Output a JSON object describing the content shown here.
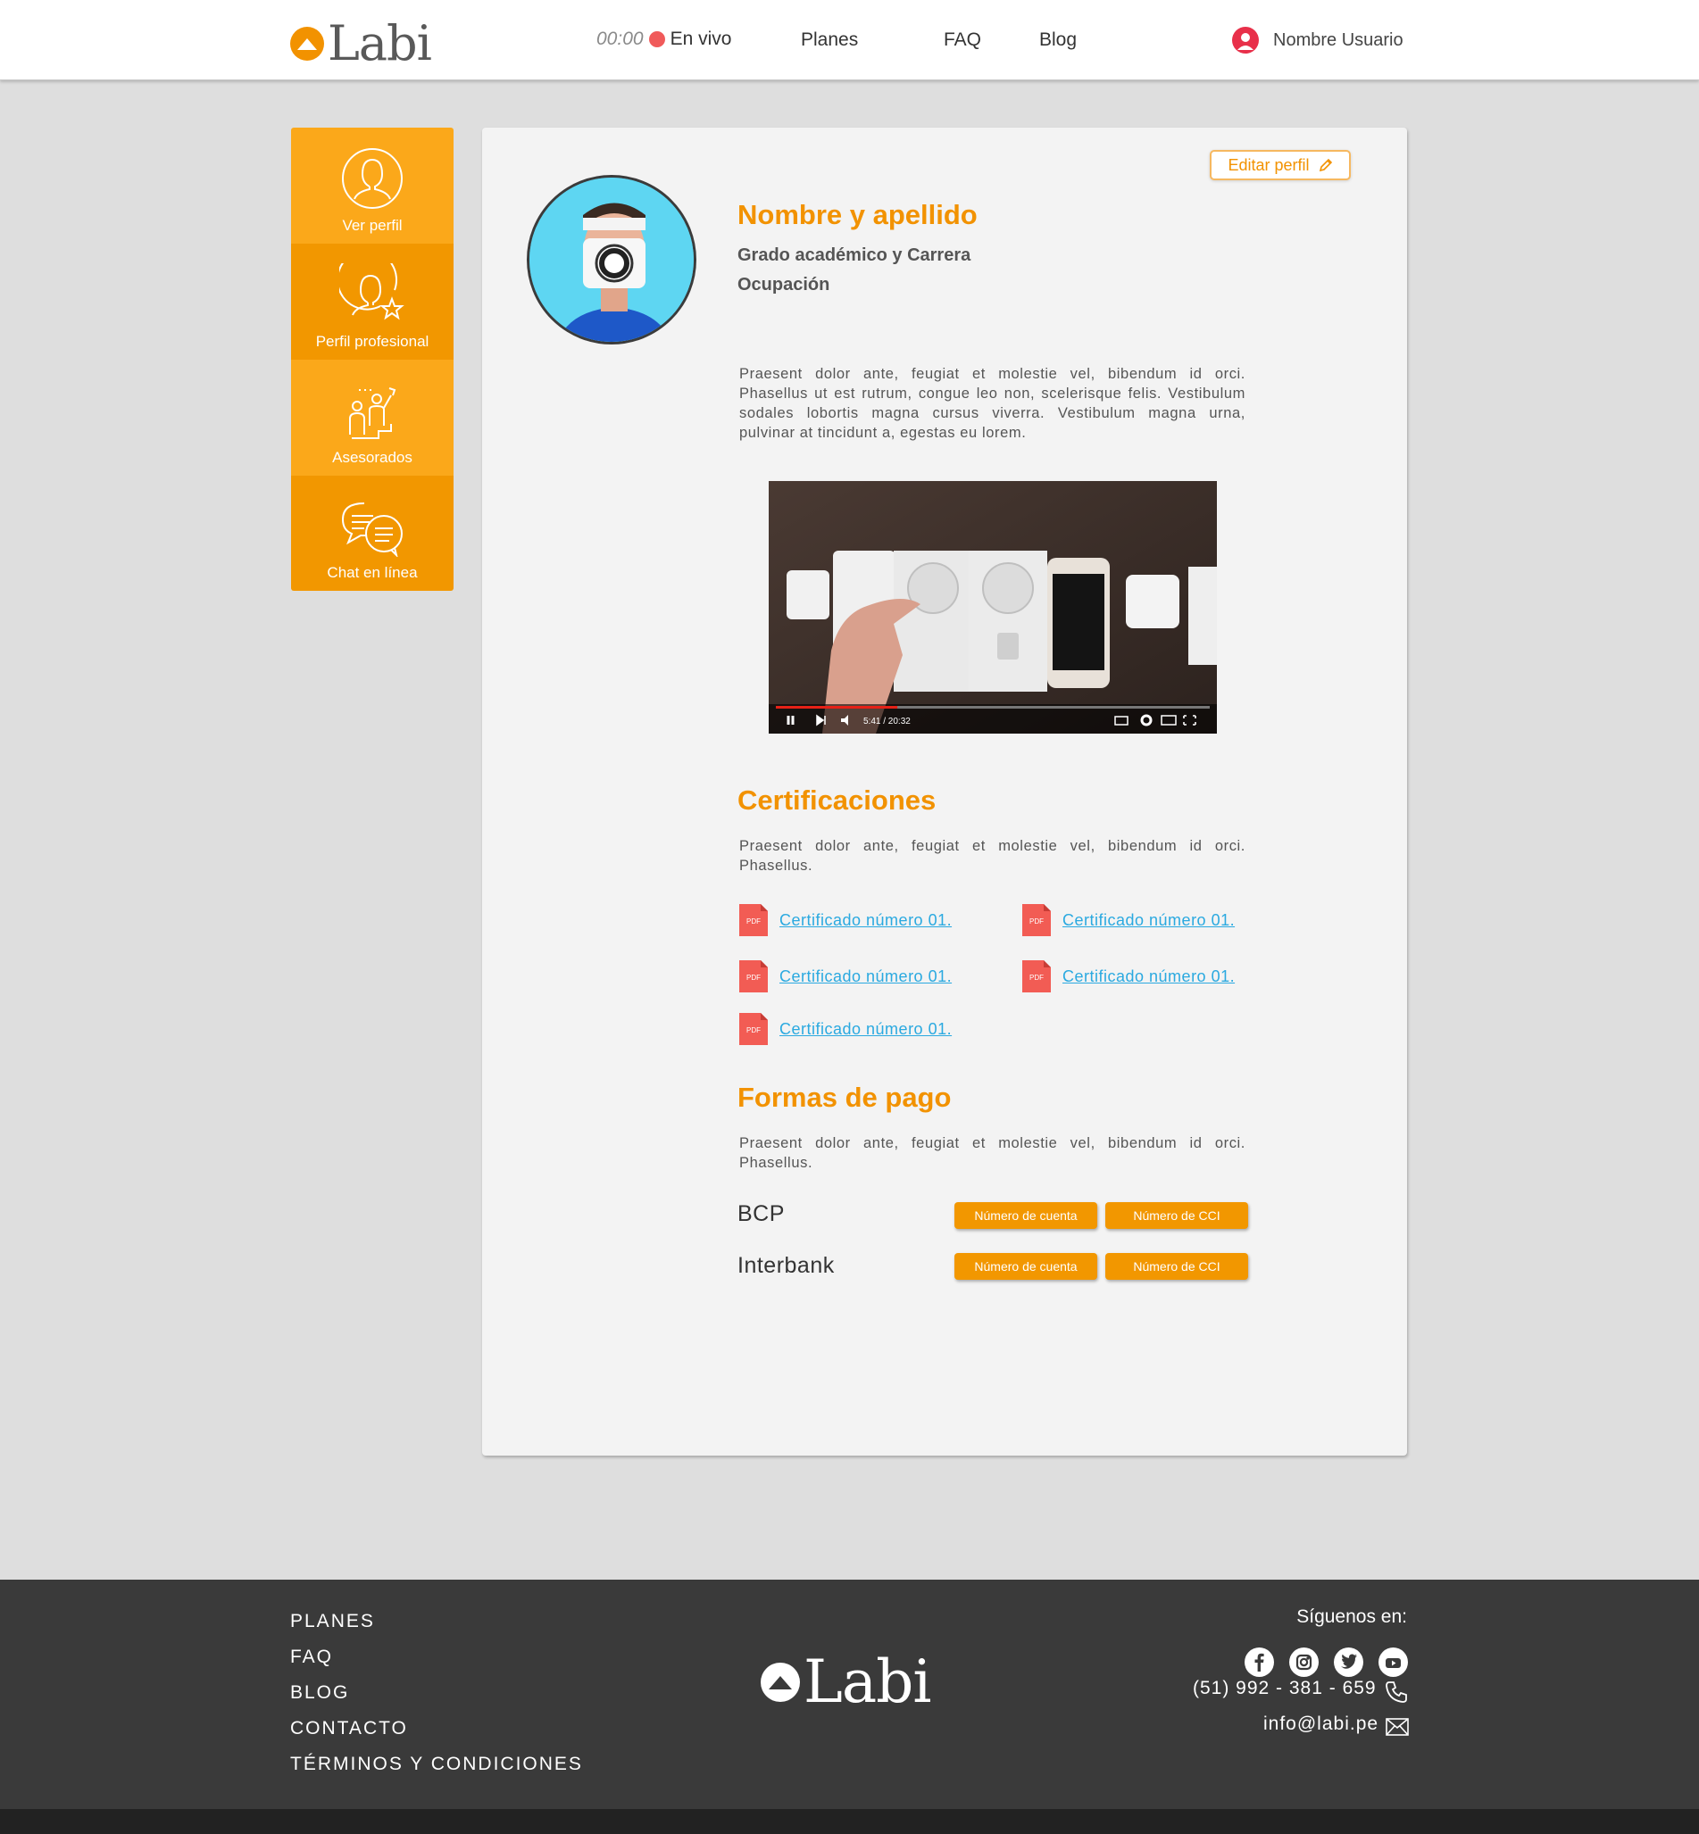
{
  "header": {
    "logo_text": "Labi",
    "live_time": "00:00",
    "live_label": "En vivo",
    "nav": [
      "Planes",
      "FAQ",
      "Blog"
    ],
    "user_name": "Nombre Usuario"
  },
  "sidebar": {
    "items": [
      {
        "label": "Ver perfil",
        "icon": "user-icon"
      },
      {
        "label": "Perfil profesional",
        "icon": "user-star-icon"
      },
      {
        "label": "Asesorados",
        "icon": "mentoring-icon"
      },
      {
        "label": "Chat en línea",
        "icon": "chat-icon"
      }
    ]
  },
  "profile": {
    "edit_label": "Editar perfil",
    "name": "Nombre y apellido",
    "degree": "Grado académico y Carrera",
    "occupation": "Ocupación",
    "bio": "Praesent dolor ante, feugiat et molestie vel, bibendum id orci. Phasellus ut est rutrum, congue leo non, scelerisque felis. Vestibulum sodales lobortis magna cursus viverra. Vestibulum magna urna, pulvinar at tincidunt a, egestas eu lorem."
  },
  "video": {
    "time": "5:41 / 20:32",
    "progress": 0.28
  },
  "certifications": {
    "title": "Certificaciones",
    "text": "Praesent dolor ante, feugiat et molestie vel, bibendum id orci. Phasellus.",
    "pdf_badge": "PDF",
    "items": [
      "Certificado número 01.",
      "Certificado número 01.",
      "Certificado número 01.",
      "Certificado número 01.",
      "Certificado número 01."
    ]
  },
  "payments": {
    "title": "Formas de pago",
    "text": "Praesent dolor ante, feugiat et molestie vel, bibendum id orci. Phasellus.",
    "banks": [
      {
        "name": "BCP",
        "account_label": "Número de cuenta",
        "cci_label": "Número de CCI"
      },
      {
        "name": "Interbank",
        "account_label": "Número de cuenta",
        "cci_label": "Número de CCI"
      }
    ]
  },
  "footer": {
    "links": [
      "PLANES",
      "FAQ",
      "BLOG",
      "CONTACTO",
      "TÉRMINOS Y CONDICIONES"
    ],
    "logo_text": "Labi",
    "follow_label": "Síguenos en:",
    "socials": [
      "facebook-icon",
      "instagram-icon",
      "twitter-icon",
      "youtube-icon"
    ],
    "phone": "(51) 992 - 381 - 659",
    "email": "info@labi.pe"
  },
  "colors": {
    "accent": "#f29200",
    "sidebar_light": "#fba81a",
    "sidebar_dark": "#f29700",
    "link": "#2aa9e0",
    "footer_bg": "#3a3a3a",
    "live_dot": "#f05a5a"
  }
}
